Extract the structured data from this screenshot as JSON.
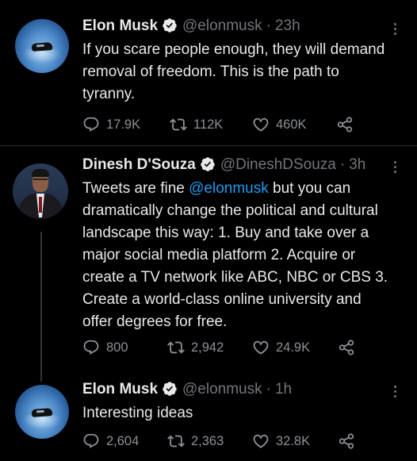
{
  "tweets": [
    {
      "author_name": "Elon Musk",
      "handle": "@elonmusk",
      "separator": "·",
      "time": "23h",
      "text": "If you scare people enough, they will demand removal of freedom. This is the path to tyranny.",
      "replies": "17.9K",
      "retweets": "112K",
      "likes": "460K"
    },
    {
      "author_name": "Dinesh D'Souza",
      "handle": "@DineshDSouza",
      "separator": "·",
      "time": "3h",
      "text_before": "Tweets are fine ",
      "mention": "@elonmusk",
      "text_after": " but you can dramatically change the political and cultural landscape this way: 1. Buy and take over a major social media platform 2. Acquire or create a TV network like ABC, NBC or CBS 3. Create a world-class online university and offer degrees for free.",
      "replies": "800",
      "retweets": "2,942",
      "likes": "24.9K"
    },
    {
      "author_name": "Elon Musk",
      "handle": "@elonmusk",
      "separator": "·",
      "time": "1h",
      "text": "Interesting ideas",
      "replies": "2,604",
      "retweets": "2,363",
      "likes": "32.8K"
    }
  ],
  "colors": {
    "background": "#000000",
    "text": "#e7e9ea",
    "muted": "#71767b",
    "mention": "#1d9bf0",
    "verified_badge": "#e7e9ea"
  },
  "icons": [
    "verified-badge-icon",
    "more-icon",
    "reply-icon",
    "retweet-icon",
    "like-icon",
    "share-icon"
  ]
}
